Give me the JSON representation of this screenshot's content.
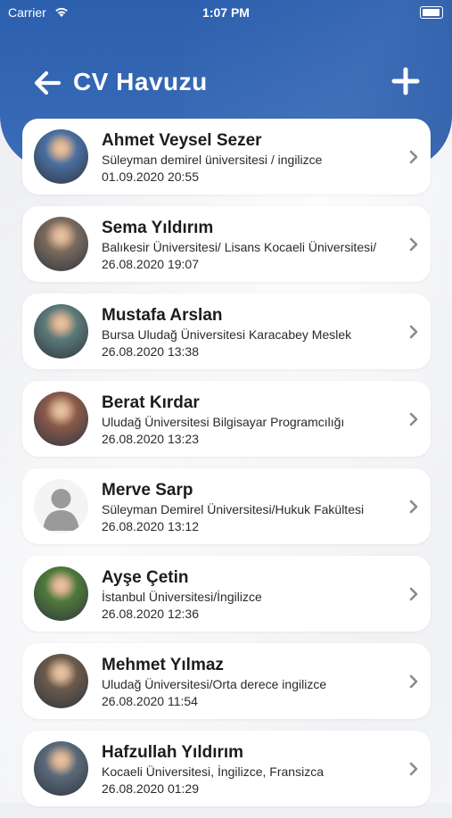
{
  "status": {
    "carrier": "Carrier",
    "time": "1:07 PM"
  },
  "nav": {
    "title": "CV Havuzu"
  },
  "colors": {
    "header": "#2c5fae",
    "card": "#ffffff",
    "text": "#1c1c1c"
  },
  "icons": {
    "back": "arrow-left-icon",
    "add": "plus-icon",
    "chevron": "chevron-right-icon"
  },
  "candidates": [
    {
      "name": "Ahmet Veysel Sezer",
      "school": "Süleyman demirel üniversitesi / ingilizce",
      "date": "01.09.2020 20:55",
      "avatar": "#4a6fa0"
    },
    {
      "name": "Sema Yıldırım",
      "school": "Balıkesir Üniversitesi/ Lisans Kocaeli Üniversitesi/",
      "date": "26.08.2020 19:07",
      "avatar": "#7a6a5c"
    },
    {
      "name": "Mustafa Arslan",
      "school": "Bursa Uludağ Üniversitesi Karacabey Meslek",
      "date": "26.08.2020 13:38",
      "avatar": "#5c7a7a"
    },
    {
      "name": "Berat Kırdar",
      "school": "Uludağ Üniversitesi Bilgisayar Programcılığı",
      "date": "26.08.2020 13:23",
      "avatar": "#8a5a4a"
    },
    {
      "name": "Merve Sarp",
      "school": "Süleyman Demirel Üniversitesi/Hukuk Fakültesi",
      "date": "26.08.2020 13:12",
      "avatar": "placeholder"
    },
    {
      "name": "Ayşe Çetin",
      "school": "İstanbul Üniversitesi/İngilizce",
      "date": "26.08.2020 12:36",
      "avatar": "#4f7a3a"
    },
    {
      "name": "Mehmet Yılmaz",
      "school": "Uludağ Üniversitesi/Orta derece ingilizce",
      "date": "26.08.2020 11:54",
      "avatar": "#6a5a4c"
    },
    {
      "name": "Hafzullah Yıldırım",
      "school": "Kocaeli Üniversitesi, İngilizce, Fransizca",
      "date": "26.08.2020 01:29",
      "avatar": "#5a6a7a"
    }
  ]
}
